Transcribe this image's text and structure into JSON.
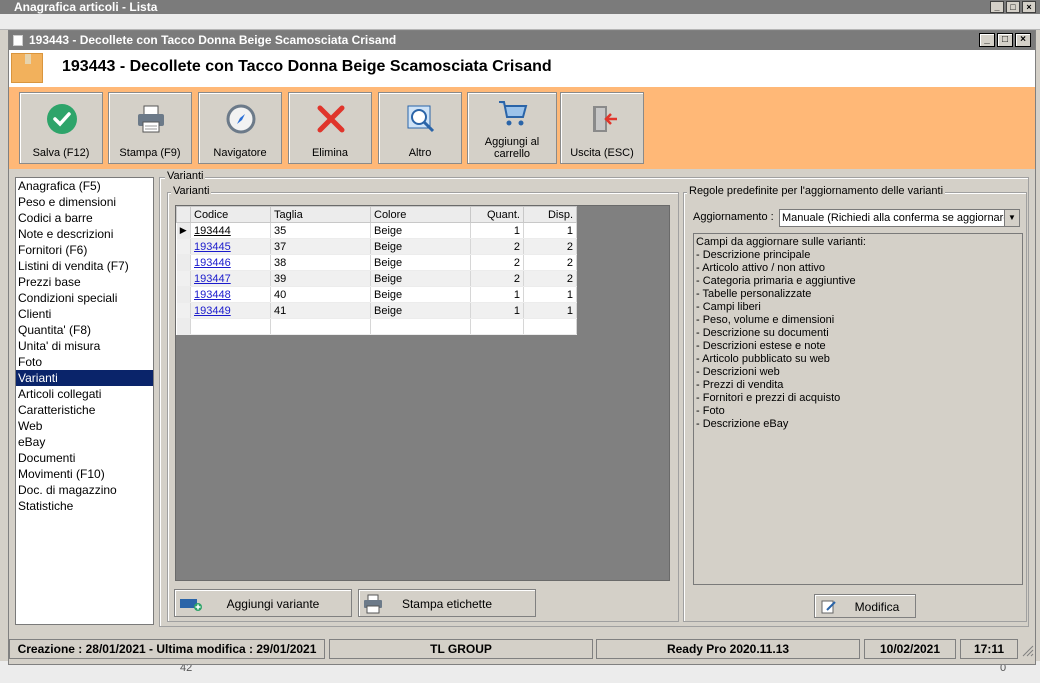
{
  "background_window": {
    "title": "Anagrafica articoli - Lista",
    "bottom_left_value": "42",
    "bottom_right_value": "0"
  },
  "dialog": {
    "title": "193443 - Decollete con Tacco Donna Beige Scamosciata Crisand",
    "header_title": "193443 - Decollete con Tacco Donna Beige Scamosciata Crisand"
  },
  "toolbar": [
    {
      "label": "Salva (F12)",
      "icon": "check-icon"
    },
    {
      "label": "Stampa (F9)",
      "icon": "printer-icon"
    },
    {
      "label": "Navigatore",
      "icon": "compass-icon"
    },
    {
      "label": "Elimina",
      "icon": "delete-x-icon"
    },
    {
      "label": "Altro",
      "icon": "magnifier-icon"
    },
    {
      "label": "Aggiungi al carrello",
      "icon": "cart-icon"
    },
    {
      "label": "Uscita (ESC)",
      "icon": "exit-door-icon"
    }
  ],
  "nav": [
    "Anagrafica (F5)",
    "Peso e dimensioni",
    "Codici a barre",
    "Note e descrizioni",
    "Fornitori (F6)",
    "Listini di vendita (F7)",
    "Prezzi base",
    "Condizioni speciali",
    "Clienti",
    "Quantita' (F8)",
    "Unita' di misura",
    "Foto",
    "Varianti",
    "Articoli collegati",
    "Caratteristiche",
    "Web",
    "eBay",
    "Documenti",
    "Movimenti (F10)",
    "Doc. di magazzino",
    "Statistiche"
  ],
  "nav_selected": "Varianti",
  "varianti_section": {
    "outer_label": "Varianti",
    "inner_label": "Varianti",
    "columns": [
      "Codice",
      "Taglia",
      "Colore",
      "Quant.",
      "Disp."
    ],
    "rows": [
      [
        "193444",
        "35",
        "Beige",
        "1",
        "1"
      ],
      [
        "193445",
        "37",
        "Beige",
        "2",
        "2"
      ],
      [
        "193446",
        "38",
        "Beige",
        "2",
        "2"
      ],
      [
        "193447",
        "39",
        "Beige",
        "2",
        "2"
      ],
      [
        "193448",
        "40",
        "Beige",
        "1",
        "1"
      ],
      [
        "193449",
        "41",
        "Beige",
        "1",
        "1"
      ]
    ],
    "add_button": "Aggiungi variante",
    "print_button": "Stampa etichette"
  },
  "rules": {
    "label": "Regole predefinite per l'aggiornamento delle varianti",
    "update_label": "Aggiornamento :",
    "update_value": "Manuale (Richiedi alla conferma se aggiornare",
    "fields_title": "Campi da aggiornare sulle varianti:",
    "fields": [
      "- Descrizione principale",
      "- Articolo attivo / non attivo",
      "- Categoria primaria e aggiuntive",
      "- Tabelle personalizzate",
      "- Campi liberi",
      "- Peso, volume e dimensioni",
      "- Descrizione su documenti",
      "- Descrizioni estese e note",
      "- Articolo pubblicato su web",
      "- Descrizioni web",
      "- Prezzi di vendita",
      "- Fornitori e prezzi di acquisto",
      "- Foto",
      "- Descrizione eBay"
    ],
    "modify_button": "Modifica"
  },
  "status": {
    "created": "Creazione : 28/01/2021 - Ultima modifica : 29/01/2021",
    "company": "TL GROUP",
    "version": "Ready Pro 2020.11.13",
    "date": "10/02/2021",
    "time": "17:11"
  },
  "colors": {
    "toolbar_bg": "#ffb877",
    "selection": "#0a246a",
    "title_bar": "#7b7b7b"
  }
}
